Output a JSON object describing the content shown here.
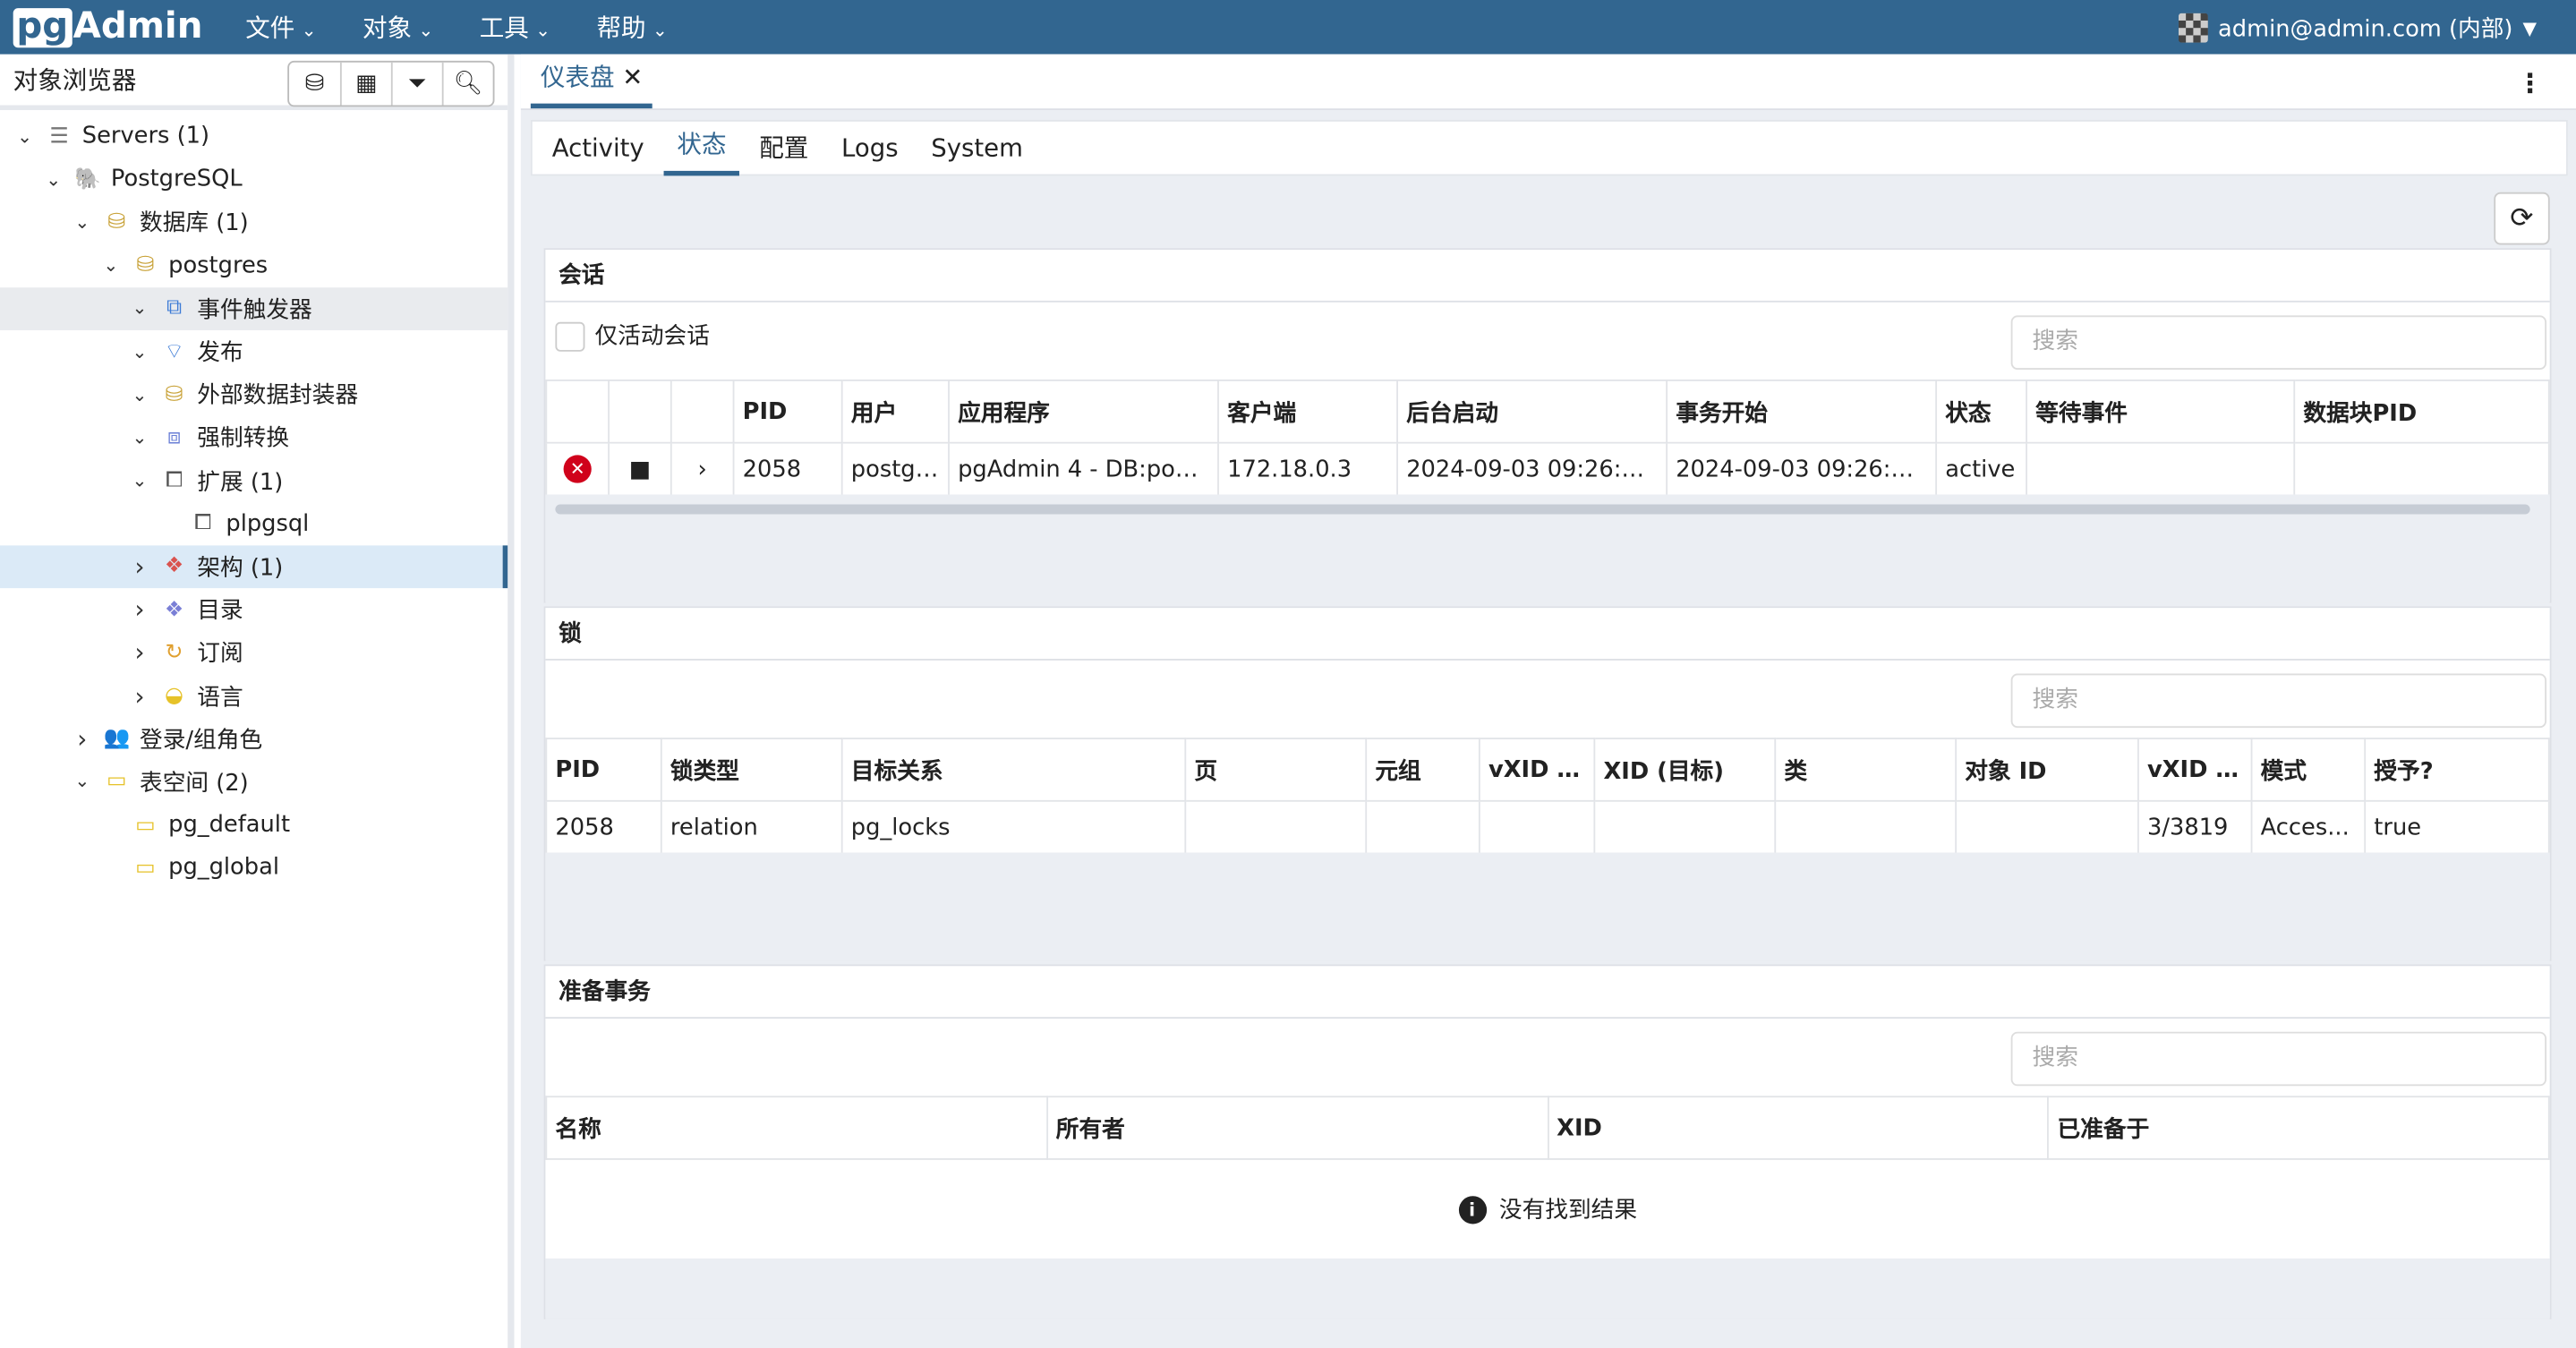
{
  "header": {
    "logo": "pgAdmin",
    "logo_prefix": "pg",
    "logo_suffix": "Admin",
    "menus": [
      "文件",
      "对象",
      "工具",
      "帮助"
    ],
    "user": "admin@admin.com (内部)"
  },
  "sidebar": {
    "title": "对象浏览器",
    "tree": [
      {
        "label": "Servers (1)",
        "depth": 0,
        "chev": "v",
        "icon": "servers-icon",
        "glyph": "☰",
        "color": "#777"
      },
      {
        "label": "PostgreSQL",
        "depth": 1,
        "chev": "v",
        "icon": "postgresql-elephant-icon",
        "glyph": "🐘",
        "color": "#336791"
      },
      {
        "label": "数据库 (1)",
        "depth": 2,
        "chev": "v",
        "icon": "databases-icon",
        "glyph": "⛁",
        "color": "#c9a33a"
      },
      {
        "label": "postgres",
        "depth": 3,
        "chev": "v",
        "icon": "database-icon",
        "glyph": "⛁",
        "color": "#c9a33a"
      },
      {
        "label": "事件触发器",
        "depth": 4,
        "chev": "v",
        "icon": "event-trigger-icon",
        "glyph": "⧉",
        "color": "#3d7bd6",
        "state": "hov"
      },
      {
        "label": "发布",
        "depth": 4,
        "chev": "v",
        "icon": "publication-icon",
        "glyph": "⌔",
        "color": "#3d7bd6"
      },
      {
        "label": "外部数据封装器",
        "depth": 4,
        "chev": "v",
        "icon": "foreign-data-wrapper-icon",
        "glyph": "⛁",
        "color": "#c9a33a"
      },
      {
        "label": "强制转换",
        "depth": 4,
        "chev": "v",
        "icon": "cast-icon",
        "glyph": "⧈",
        "color": "#6a7fd6"
      },
      {
        "label": "扩展 (1)",
        "depth": 4,
        "chev": "v",
        "icon": "extensions-icon",
        "glyph": "⧠",
        "color": "#555"
      },
      {
        "label": "plpgsql",
        "depth": 5,
        "chev": "",
        "icon": "extension-icon",
        "glyph": "⧠",
        "color": "#555"
      },
      {
        "label": "架构 (1)",
        "depth": 4,
        "chev": ">",
        "icon": "schemas-icon",
        "glyph": "❖",
        "color": "#d9534f",
        "state": "sel"
      },
      {
        "label": "目录",
        "depth": 4,
        "chev": ">",
        "icon": "catalogs-icon",
        "glyph": "❖",
        "color": "#7a7fd6"
      },
      {
        "label": "订阅",
        "depth": 4,
        "chev": ">",
        "icon": "subscriptions-icon",
        "glyph": "↻",
        "color": "#e0a030"
      },
      {
        "label": "语言",
        "depth": 4,
        "chev": ">",
        "icon": "languages-icon",
        "glyph": "◒",
        "color": "#e6c229"
      },
      {
        "label": "登录/组角色",
        "depth": 2,
        "chev": ">",
        "icon": "login-roles-icon",
        "glyph": "👥",
        "color": "#d9534f"
      },
      {
        "label": "表空间 (2)",
        "depth": 2,
        "chev": "v",
        "icon": "tablespaces-icon",
        "glyph": "▭",
        "color": "#e6c229"
      },
      {
        "label": "pg_default",
        "depth": 3,
        "chev": "",
        "icon": "folder-icon",
        "glyph": "▭",
        "color": "#e6c229"
      },
      {
        "label": "pg_global",
        "depth": 3,
        "chev": "",
        "icon": "folder-icon",
        "glyph": "▭",
        "color": "#e6c229"
      }
    ]
  },
  "tab": {
    "label": "仪表盘"
  },
  "subtabs": [
    "Activity",
    "状态",
    "配置",
    "Logs",
    "System"
  ],
  "sessions": {
    "title": "会话",
    "filter_label": "仅活动会话",
    "search_placeholder": "搜索",
    "columns": [
      "",
      "",
      "",
      "PID",
      "用户",
      "应用程序",
      "客户端",
      "后台启动",
      "事务开始",
      "状态",
      "等待事件",
      "数据块PID"
    ],
    "rows": [
      [
        "2058",
        "postgr...",
        "pgAdmin 4 - DB:post...",
        "172.18.0.3",
        "2024-09-03 09:26:23...",
        "2024-09-03 09:26:33...",
        "active",
        "",
        ""
      ]
    ]
  },
  "locks": {
    "title": "锁",
    "search_placeholder": "搜索",
    "columns": [
      "PID",
      "锁类型",
      "目标关系",
      "页",
      "元组",
      "vXID (...",
      "XID (目标)",
      "类",
      "对象 ID",
      "vXID (...",
      "模式",
      "授予?"
    ],
    "rows": [
      [
        "2058",
        "relation",
        "pg_locks",
        "",
        "",
        "",
        "",
        "",
        "",
        "3/3819",
        "Acces...",
        "true"
      ]
    ]
  },
  "prepared": {
    "title": "准备事务",
    "search_placeholder": "搜索",
    "columns": [
      "名称",
      "所有者",
      "XID",
      "已准备于"
    ],
    "empty": "没有找到结果"
  }
}
